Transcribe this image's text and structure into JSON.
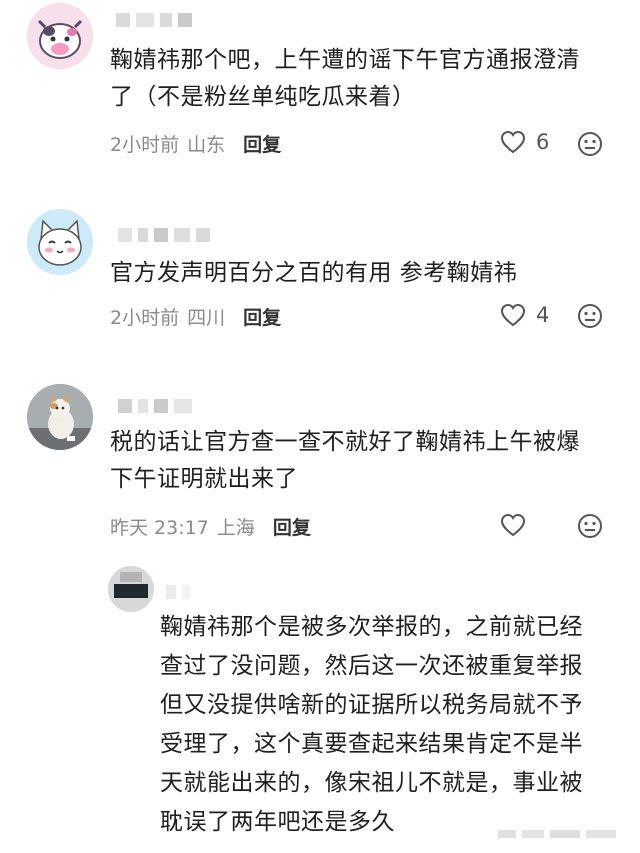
{
  "comments": [
    {
      "text_line1": "鞠婧祎那个吧，上午遭的谣下午官方通报澄清",
      "text_line2": "了（不是粉丝单纯吃瓜来着）",
      "time": "2小时前",
      "location": "山东",
      "reply_label": "回复",
      "likes": "6"
    },
    {
      "text_line1": "官方发声明百分之百的有用 参考鞠婧祎",
      "time": "2小时前",
      "location": "四川",
      "reply_label": "回复",
      "likes": "4"
    },
    {
      "text_line1": "税的话让官方查一查不就好了鞠婧祎上午被爆",
      "text_line2": "下午证明就出来了",
      "time": "昨天 23:17",
      "location": "上海",
      "reply_label": "回复",
      "likes": ""
    }
  ],
  "sub_reply": {
    "lines": [
      "鞠婧祎那个是被多次举报的，之前就已经",
      "查过了没问题，然后这一次还被重复举报",
      "但又没提供啥新的证据所以税务局就不予",
      "受理了，这个真要查起来结果肯定不是半",
      "天就能出来的，像宋祖儿不就是，事业被",
      "耽误了两年吧还是多久"
    ]
  },
  "icons": {
    "like": "heart-outline-icon",
    "dislike": "neutral-face-icon"
  },
  "colors": {
    "text": "#1f1f1f",
    "meta": "#8a8a8a",
    "reply": "#333333"
  }
}
